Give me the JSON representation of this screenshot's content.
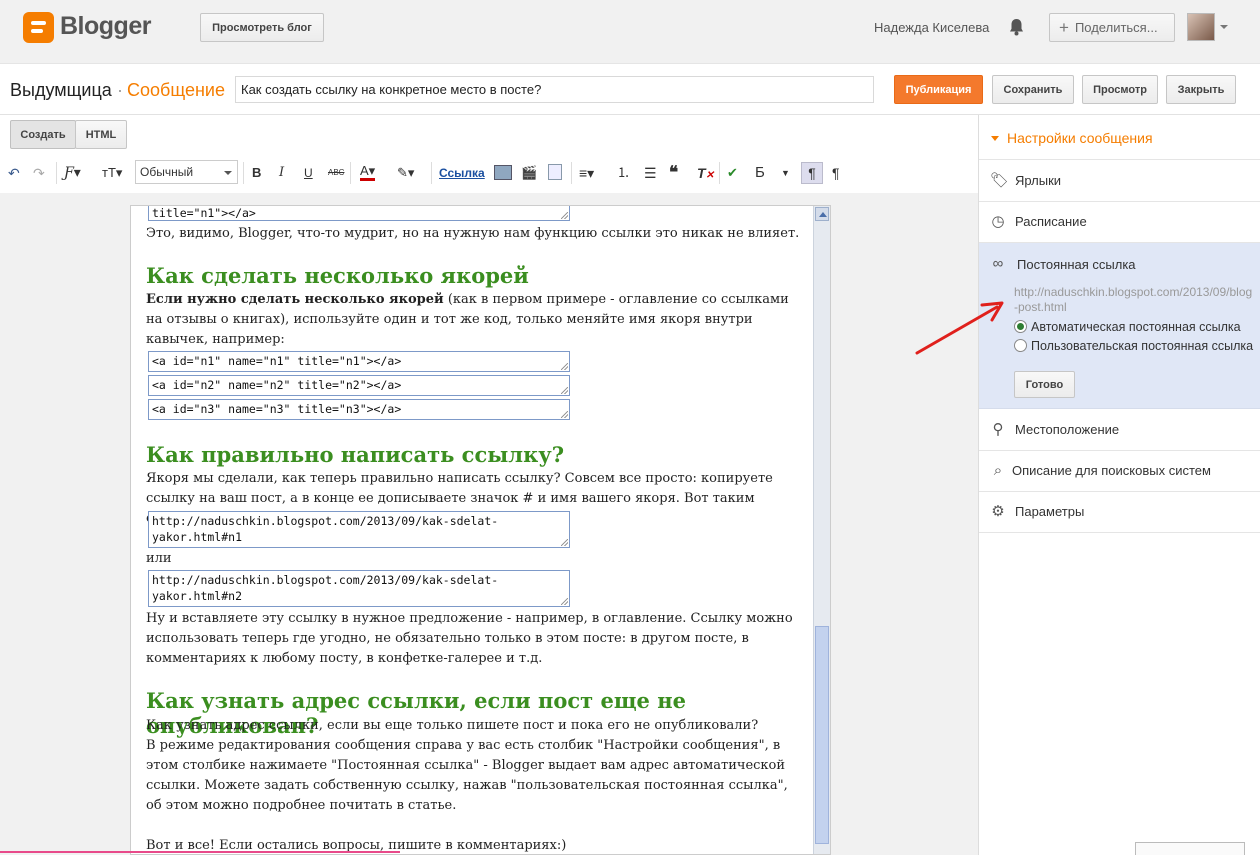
{
  "topbar": {
    "logo_text": "Blogger",
    "view_blog": "Просмотреть блог",
    "user_name": "Надежда Киселева",
    "share": "Поделиться..."
  },
  "titlebar": {
    "blog_name": "Выдумщица",
    "separator": "·",
    "post_label": "Сообщение",
    "post_title": "Как создать ссылку на конкретное место в посте?",
    "publish": "Публикация",
    "save": "Сохранить",
    "preview": "Просмотр",
    "close": "Закрыть"
  },
  "modes": {
    "create": "Создать",
    "html": "HTML"
  },
  "toolbar": {
    "font_style": "Обычный",
    "bold": "B",
    "italic": "I",
    "underline": "U",
    "strike": "ABC",
    "link": "Ссылка",
    "text_dir": "Б"
  },
  "editor": {
    "code0": "title=\"n1\"></a>",
    "p0": "Это, видимо, Blogger, что-то мудрит, но на нужную нам функцию ссылки это никак не влияет.",
    "h1": "Как сделать несколько якорей",
    "p1_bold": "Если нужно сделать несколько якорей",
    "p1_rest": " (как в первом примере - оглавление со ссылками на отзывы о книгах), используйте один и тот же код, только меняйте имя якоря внутри кавычек, например:",
    "code1": "<a id=\"n1\" name=\"n1\" title=\"n1\"></a>",
    "code2": "<a id=\"n2\" name=\"n2\" title=\"n2\"></a>",
    "code3": "<a id=\"n3\" name=\"n3\" title=\"n3\"></a>",
    "h2": "Как правильно написать ссылку?",
    "p2": "Якоря мы сделали, как теперь правильно написать ссылку? Совсем все просто: копируете ссылку на ваш пост, а в конце ее дописываете значок # и имя вашего якоря. Вот таким образом:",
    "code4": "http://naduschkin.blogspot.com/2013/09/kak-sdelat-\nyakor.html#n1",
    "or": "или",
    "code5": "http://naduschkin.blogspot.com/2013/09/kak-sdelat-\nyakor.html#n2",
    "p3": "Ну и вставляете эту ссылку в нужное предложение - например, в оглавление. Ссылку можно использовать теперь где угодно, не обязательно только в этом посте: в другом посте, в комментариях к любому посту, в конфетке-галерее и т.д.",
    "h3": "Как узнать адрес ссылки, если пост еще не опубликован?",
    "p4a": "Как узнать адрес ссылки, если вы еще только пишете пост и пока его не опубликовали?",
    "p4b": "В режиме редактирования сообщения справа у вас есть столбик \"Настройки сообщения\", в этом столбике нажимаете \"Постоянная ссылка\" - Blogger выдает вам адрес автоматической ссылки. Можете задать собственную ссылку, нажав \"пользовательская постоянная ссылка\", об этом можно подробнее почитать в статье.",
    "p5": "Вот и все! Если остались вопросы, пишите в комментариях:)"
  },
  "sidebar": {
    "title": "Настройки сообщения",
    "labels": "Ярлыки",
    "schedule": "Расписание",
    "permalink": "Постоянная ссылка",
    "permalink_url": "http://naduschkin.blogspot.com/2013/09/blog-post.html",
    "auto_permalink": "Автоматическая постоянная ссылка",
    "custom_permalink": "Пользовательская постоянная ссылка",
    "done": "Готово",
    "location": "Местоположение",
    "search_description": "Описание для поисковых систем",
    "options": "Параметры",
    "auto_selected": true
  },
  "colors": {
    "accent": "#f57d00",
    "heading": "#3b8e20",
    "selected_panel": "#e0e7f6"
  }
}
